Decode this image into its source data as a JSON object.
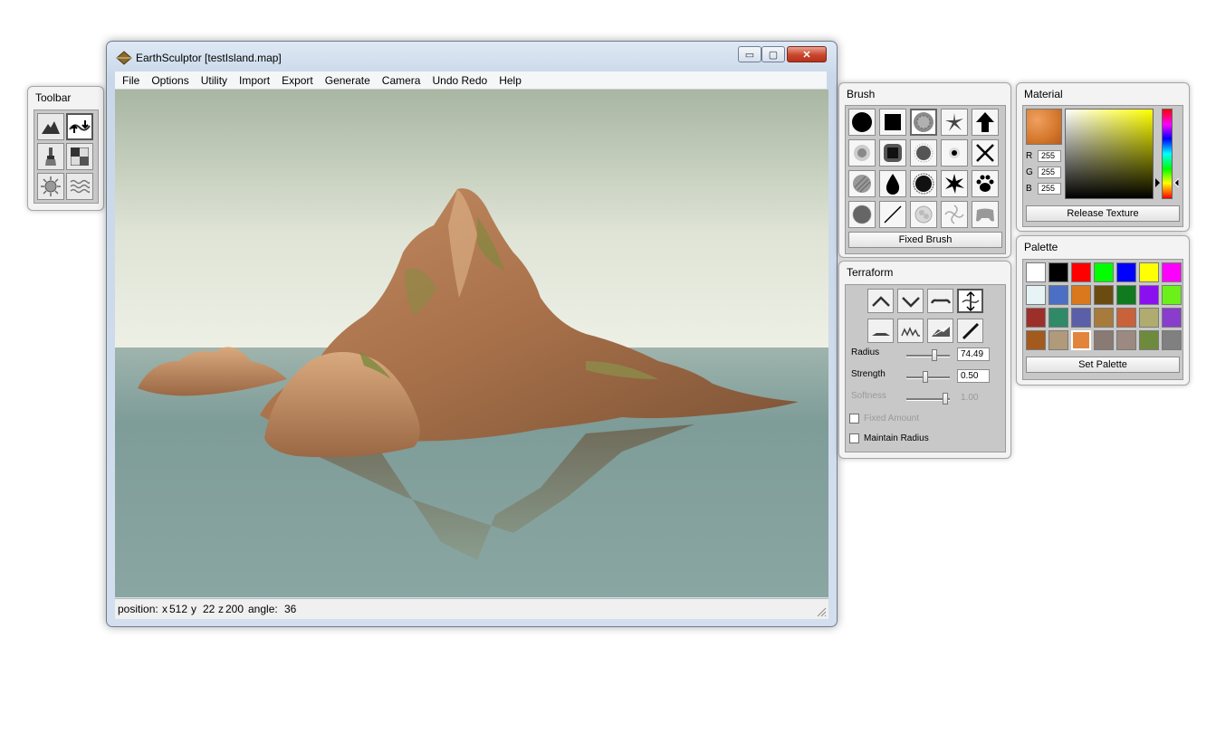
{
  "window": {
    "title": "EarthSculptor [testIsland.map]",
    "minimize_glyph": "▭",
    "maximize_glyph": "▢",
    "close_glyph": "✕"
  },
  "menu": [
    "File",
    "Options",
    "Utility",
    "Import",
    "Export",
    "Generate",
    "Camera",
    "Undo Redo",
    "Help"
  ],
  "status": {
    "position_label": "position:",
    "x_label": "x",
    "x": "512",
    "y_label": "y",
    "y": "22",
    "z_label": "z",
    "z": "200",
    "angle_label": "angle:",
    "angle": "36"
  },
  "toolbar": {
    "title": "Toolbar",
    "tools": [
      "mountain-icon",
      "raise-lower-icon",
      "paint-brush-icon",
      "checker-icon",
      "sun-icon",
      "waves-icon"
    ],
    "selected": 1
  },
  "brush": {
    "title": "Brush",
    "shapes": [
      "solid-circle-icon",
      "solid-square-icon",
      "noise-circle-icon",
      "splat-icon",
      "arrow-up-icon",
      "dots-icon",
      "soft-square-icon",
      "spatter-icon",
      "small-dot-icon",
      "x-mark-icon",
      "striped-circle-icon",
      "drop-icon",
      "blob-icon",
      "star-burst-icon",
      "paw-icon",
      "rough-circle-icon",
      "line-icon",
      "cloud-icon",
      "swirl-icon",
      "gamepad-icon"
    ],
    "selected": 2,
    "fixed_button": "Fixed Brush"
  },
  "terraform": {
    "title": "Terraform",
    "tools": [
      "raise-icon",
      "lower-icon",
      "flatten-icon",
      "raise-lower-icon",
      "plateau-icon",
      "noise-icon",
      "erode-icon",
      "smooth-icon"
    ],
    "selected": 3,
    "radius_label": "Radius",
    "radius_value": "74.49",
    "radius_level": 0.66,
    "strength_label": "Strength",
    "strength_value": "0.50",
    "strength_level": 0.42,
    "softness_label": "Softness",
    "softness_value": "1.00",
    "softness_level": 0.95,
    "fixed_amount_label": "Fixed Amount",
    "maintain_radius_label": "Maintain Radius"
  },
  "material": {
    "title": "Material",
    "r_label": "R",
    "r": "255",
    "g_label": "G",
    "g": "255",
    "b_label": "B",
    "b": "255",
    "release_button": "Release Texture"
  },
  "palette": {
    "title": "Palette",
    "colors": [
      "#ffffff",
      "#000000",
      "#ff0000",
      "#00ff00",
      "#0000ff",
      "#ffff00",
      "#ff00ff",
      "#e6f4f6",
      "#4a6fc4",
      "#d9781c",
      "#6b4c10",
      "#0f7a1e",
      "#8a10f0",
      "#6cf01a",
      "#9c2f2a",
      "#2f8a68",
      "#5a5fa8",
      "#a87a3c",
      "#c9623a",
      "#b0ac70",
      "#8a3ccc",
      "#a35a1c",
      "#b09a7a",
      "#e2843a",
      "#8a7a74",
      "#9c8a80",
      "#6e8a3c",
      "#808080"
    ],
    "set_button": "Set Palette"
  }
}
